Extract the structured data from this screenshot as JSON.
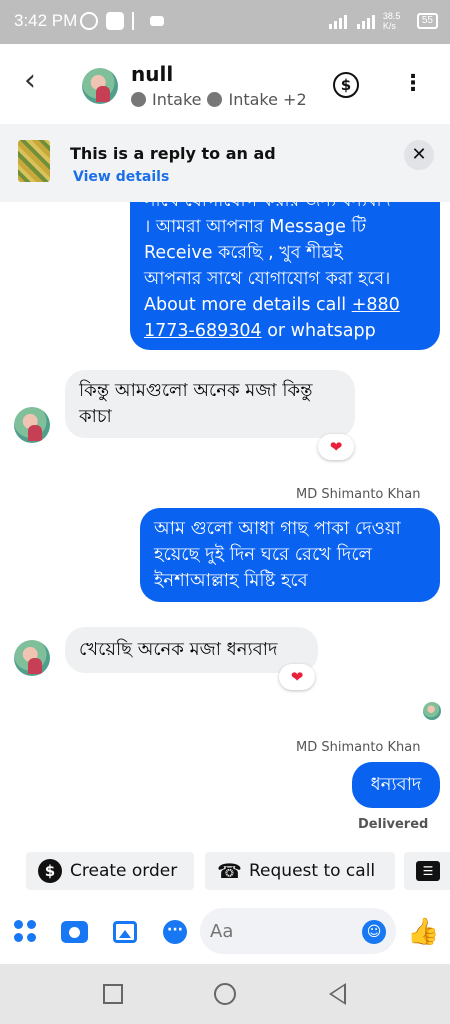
{
  "status_bar": {
    "time": "3:42 PM",
    "net_speed": "38.5 K/s",
    "battery": "55"
  },
  "header": {
    "contact_name": "null",
    "labels": [
      "Intake",
      "Intake +2"
    ],
    "back_icon": "chevron-left-icon",
    "dollar_icon": "dollar-icon",
    "more_icon": "more-vertical-icon"
  },
  "ad_reply": {
    "title": "This is a reply to an ad",
    "link": "View details"
  },
  "messages": {
    "m1": {
      "line1": "সাথে যোগাযোগ করার জন্য ধন্যবাদ",
      "line2": "। আমরা আপনার Message টি",
      "line3": "Receive করেছি , খুব শীঘ্রই",
      "line4": "আপনার সাথে যোগাযোগ করা হবে।",
      "line5_text": "About more details call ",
      "line5_link": "+880",
      "line6_link": "1773-689304",
      "line6_text": " or whatsapp"
    },
    "m2": {
      "line1": "কিন্তু আমগুলো অনেক মজা কিন্তু",
      "line2": "কাচা",
      "reaction": "❤"
    },
    "m3": {
      "sender": "MD Shimanto Khan",
      "line1": "আম গুলো আধা গাছ পাকা দেওয়া",
      "line2": "হয়েছে  দুই দিন ঘরে রেখে দিলে",
      "line3": "ইনশাআল্লাহ মিষ্টি হবে"
    },
    "m4": {
      "text": "খেয়েছি অনেক মজা ধন্যবাদ",
      "reaction": "❤"
    },
    "m5": {
      "sender": "MD Shimanto Khan",
      "text": "ধন্যবাদ",
      "status": "Delivered"
    }
  },
  "quick_actions": {
    "create_order": "Create order",
    "request_call": "Request to call"
  },
  "composer": {
    "placeholder": "Aa"
  }
}
